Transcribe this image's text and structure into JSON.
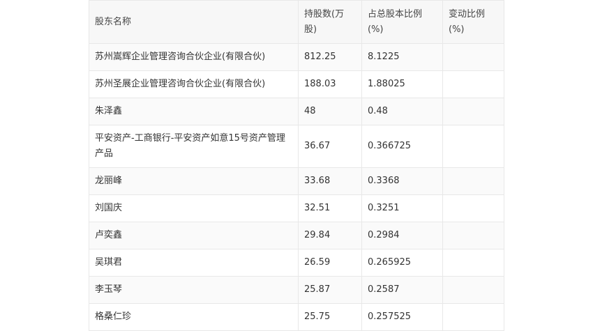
{
  "table": {
    "headers": [
      "股东名称",
      "持股数(万股)",
      "占总股本比例(%)",
      "变动比例(%)"
    ],
    "rows": [
      {
        "name": "苏州嵩辉企业管理咨询合伙企业(有限合伙)",
        "shares": "812.25",
        "ratio": "8.1225",
        "change": ""
      },
      {
        "name": "苏州圣展企业管理咨询合伙企业(有限合伙)",
        "shares": "188.03",
        "ratio": "1.88025",
        "change": ""
      },
      {
        "name": "朱泽鑫",
        "shares": "48",
        "ratio": "0.48",
        "change": ""
      },
      {
        "name": "平安资产-工商银行-平安资产如意15号资产管理产品",
        "shares": "36.67",
        "ratio": "0.366725",
        "change": ""
      },
      {
        "name": "龙丽峰",
        "shares": "33.68",
        "ratio": "0.3368",
        "change": ""
      },
      {
        "name": "刘国庆",
        "shares": "32.51",
        "ratio": "0.3251",
        "change": ""
      },
      {
        "name": "卢奕鑫",
        "shares": "29.84",
        "ratio": "0.2984",
        "change": ""
      },
      {
        "name": "吴琪君",
        "shares": "26.59",
        "ratio": "0.265925",
        "change": ""
      },
      {
        "name": "李玉琴",
        "shares": "25.87",
        "ratio": "0.2587",
        "change": ""
      },
      {
        "name": "格桑仁珍",
        "shares": "25.75",
        "ratio": "0.257525",
        "change": ""
      }
    ]
  }
}
